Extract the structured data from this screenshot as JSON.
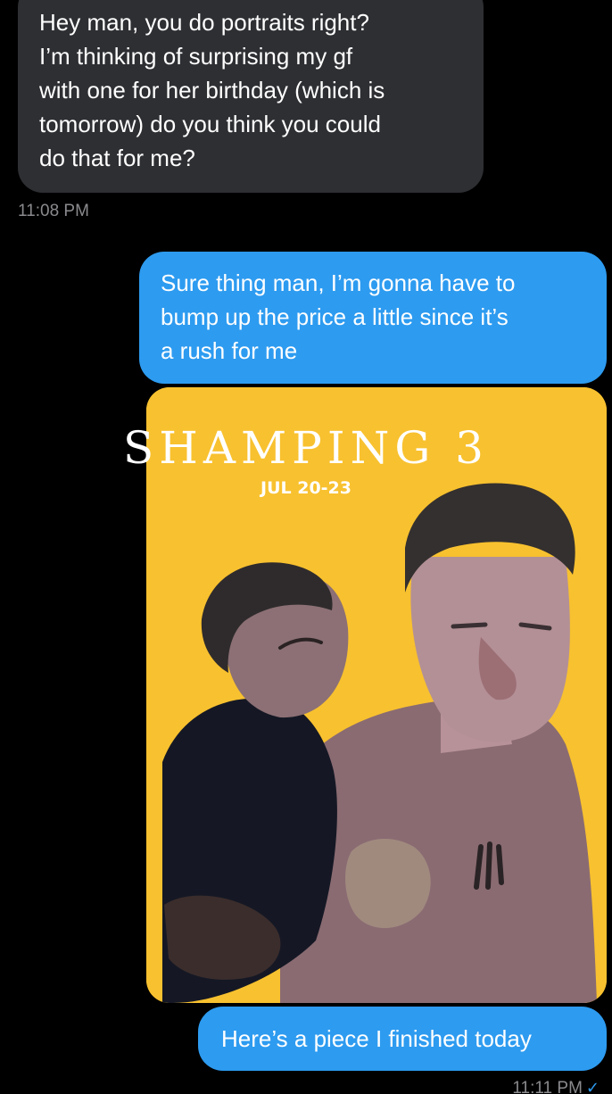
{
  "conversation": {
    "messages": [
      {
        "direction": "incoming",
        "text": "Hey man, you do portraits right? \nI’m thinking of surprising my gf \nwith one for her birthday (which is \ntomorrow) do you think you could \ndo that for me?",
        "time": "11:08 PM"
      },
      {
        "direction": "outgoing",
        "text": "Sure thing man, I’m gonna have to \nbump up the price a little since it’s \na rush for me"
      },
      {
        "direction": "outgoing",
        "type": "image",
        "poster_title": "SHAMPING 3",
        "poster_date": "JUL 20-23"
      },
      {
        "direction": "outgoing",
        "text": "Here’s a piece I finished today",
        "time": "11:11 PM",
        "status_icon": "read-checkmark-icon"
      }
    ]
  },
  "colors": {
    "incoming_bubble": "#2e2f33",
    "outgoing_bubble": "#2d9bf0",
    "poster_background": "#f8c12f",
    "timestamp": "#8a8a8e"
  }
}
